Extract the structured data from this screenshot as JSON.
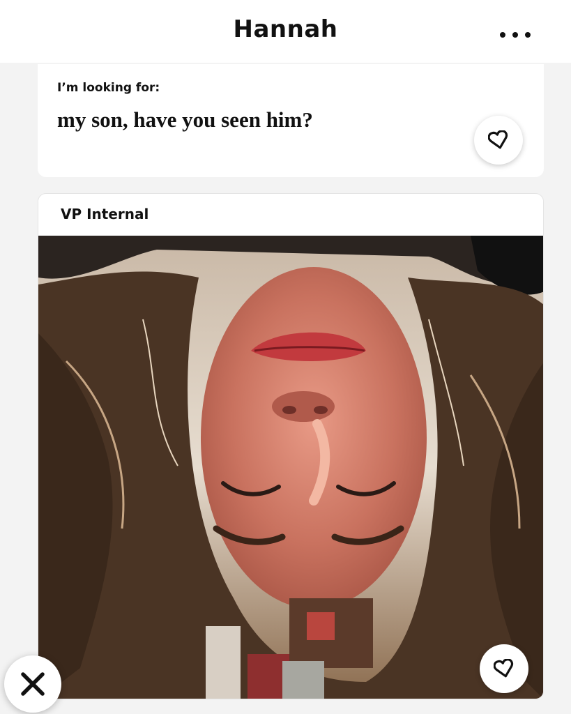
{
  "header": {
    "profile_name": "Hannah",
    "more_icon": "more-horizontal-icon"
  },
  "prompt_card": {
    "prompt": "I’m looking for:",
    "answer": "my son, have you seen him?",
    "like_icon": "heart-outline-icon"
  },
  "photo_card": {
    "caption": "VP Internal",
    "photo_description_icon": "profile-photo",
    "like_icon": "heart-outline-icon"
  },
  "actions": {
    "dismiss_icon": "close-x-icon"
  },
  "colors": {
    "background": "#f3f3f3",
    "card": "#ffffff",
    "text": "#111111"
  }
}
